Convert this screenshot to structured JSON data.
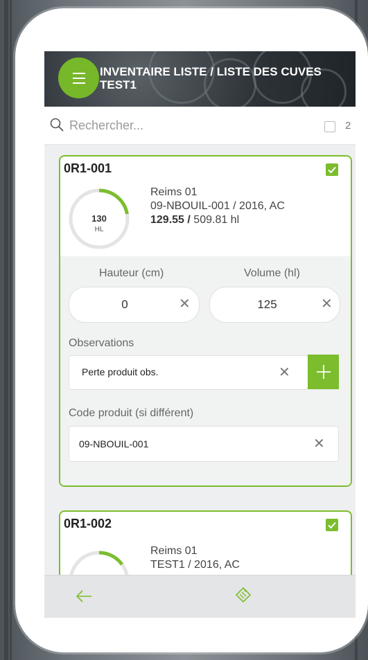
{
  "header": {
    "title_line1": "INVENTAIRE LISTE / LISTE DES CUVES",
    "title_line2": "TEST1"
  },
  "search": {
    "placeholder": "Rechercher...",
    "selected_count": "2"
  },
  "cards": [
    {
      "id": "0R1-001",
      "checked": true,
      "gauge_value": "130",
      "gauge_unit": "HL",
      "location": "Reims 01",
      "product": "09-NBOUIL-001 / 2016, AC",
      "volume_current": "129.55",
      "volume_sep": "/",
      "volume_total": "509.81 hl",
      "height_label": "Hauteur (cm)",
      "volume_label": "Volume (hl)",
      "height_value": "0",
      "volume_value": "125",
      "observations_label": "Observations",
      "observations_value": "Perte produit obs.",
      "code_label": "Code produit (si différent)",
      "code_value": "09-NBOUIL-001"
    },
    {
      "id": "0R1-002",
      "checked": true,
      "location": "Reims 01",
      "product": "TEST1 / 2016, AC"
    }
  ],
  "colors": {
    "accent": "#7cbd2d",
    "header_bg": "#2c3237"
  },
  "footer": {
    "back_icon": "arrow-left-icon",
    "scan_icon": "tag-scan-icon"
  }
}
